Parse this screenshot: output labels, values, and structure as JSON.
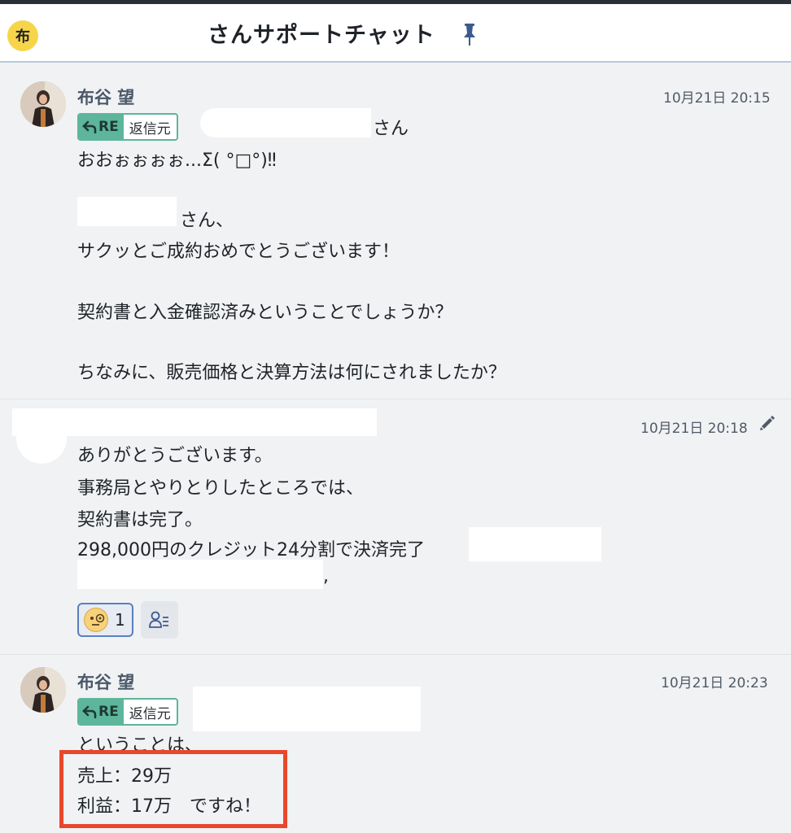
{
  "room": {
    "avatar_char": "布",
    "title": "さんサポートチャット"
  },
  "messages": [
    {
      "sender": "布谷 望",
      "time": "10月21日 20:15",
      "reply_tag": "RE",
      "reply_label": "返信元",
      "reply_suffix": "さん",
      "lines": [
        "おおぉぉぉぉ...Σ( °□°)‼",
        "さん、",
        "サクッとご成約おめでとうございます！",
        "契約書と入金確認済みということでしょうか？",
        "ちなみに、販売価格と決算方法は何にされましたか？"
      ]
    },
    {
      "sender": "",
      "time": "10月21日 20:18",
      "lines": [
        "ありがとうございます。",
        "事務局とやりとりしたところでは、",
        "契約書は完了。",
        "298,000円のクレジット24分割で決済完了",
        ","
      ],
      "reaction": {
        "emoji": "face-with-monocle",
        "count": "1"
      }
    },
    {
      "sender": "布谷 望",
      "time": "10月21日 20:23",
      "reply_tag": "RE",
      "reply_label": "返信元",
      "lines": [
        "ということは、",
        "売上：29万",
        "利益：17万　ですね！"
      ]
    }
  ],
  "colors": {
    "accent_green": "#5db59b",
    "highlight_red": "#e8472c",
    "reaction_blue": "#5b7fbf"
  }
}
